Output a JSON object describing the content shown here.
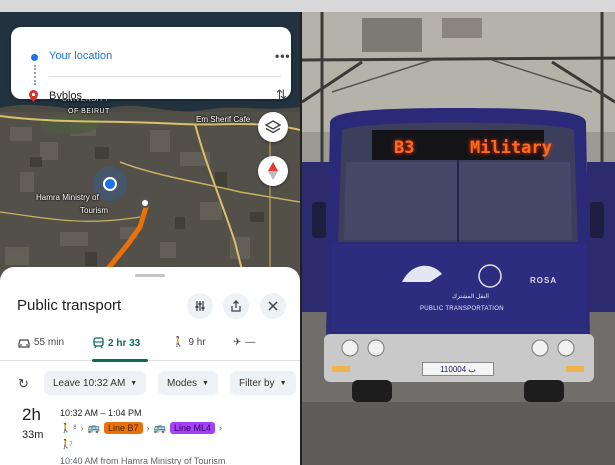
{
  "route_card": {
    "origin": "Your location",
    "destination": "Byblos",
    "more_label": "•••",
    "swap_label": "⇅"
  },
  "map": {
    "labels": {
      "university_line1": "UNIVERSITY",
      "university_line2": "OF BEIRUT",
      "em_sherif": "Em Sherif Cafe",
      "hamra_line1": "Hamra Ministry of",
      "hamra_line2": "Tourism"
    },
    "icons": {
      "layers": "layers-icon",
      "compass": "compass-icon"
    }
  },
  "sheet": {
    "title": "Public transport",
    "modes": [
      {
        "name": "drive",
        "label": "55 min"
      },
      {
        "name": "transit",
        "label": "2 hr 33"
      },
      {
        "name": "walk",
        "label": "9 hr"
      },
      {
        "name": "fly",
        "label": "—"
      }
    ],
    "filters": {
      "leave": "Leave 10:32 AM",
      "modes": "Modes",
      "filter": "Filter by"
    },
    "result": {
      "duration_hours": "2h",
      "duration_minutes": "33m",
      "times": "10:32 AM – 1:04 PM",
      "walk1_count": "8",
      "line1": "Line B7",
      "line2": "Line ML4",
      "walk2_count": "7",
      "from": "10:40 AM from Hamra Ministry of Tourism"
    }
  },
  "bus": {
    "sign_route": "B3",
    "sign_destination": "Military",
    "logo_line1": "النقل المشترك",
    "logo_line2": "PUBLIC TRANSPORTATION",
    "brand": "ROSA",
    "plate": "110004 ﺏ"
  },
  "colors": {
    "accent_blue": "#1a73e8",
    "transit_green": "#0b6b5c",
    "line_b7": "#e8710a",
    "line_ml4": "#a142f4",
    "bus_body": "#2a2a78"
  }
}
